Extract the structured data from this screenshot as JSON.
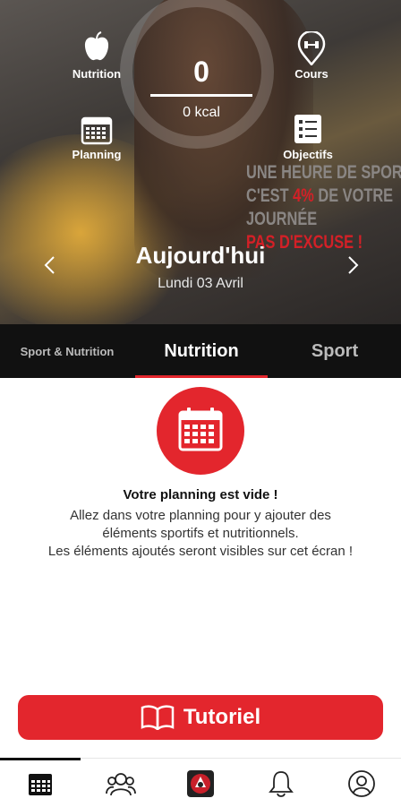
{
  "header": {
    "menu": {
      "nutrition": {
        "label": "Nutrition",
        "icon": "apple-icon"
      },
      "cours": {
        "label": "Cours",
        "icon": "dumbbell-pin-icon"
      },
      "planning": {
        "label": "Planning",
        "icon": "calendar-icon"
      },
      "objectifs": {
        "label": "Objectifs",
        "icon": "checklist-icon"
      }
    },
    "calories": {
      "value": "0",
      "label": "0 kcal"
    },
    "slogan": {
      "line1": "UNE HEURE DE SPORT",
      "line2_a": "C'EST ",
      "line2_pct": "4%",
      "line2_b": " DE VOTRE",
      "line3": "JOURNÉE",
      "line4": "PAS D'EXCUSE !"
    },
    "day": {
      "title": "Aujourd'hui",
      "date": "Lundi 03 Avril"
    }
  },
  "tabs": [
    {
      "label": "Sport & Nutrition",
      "active": false
    },
    {
      "label": "Nutrition",
      "active": true
    },
    {
      "label": "Sport",
      "active": false
    }
  ],
  "empty_state": {
    "icon": "calendar-icon",
    "title": "Votre planning est vide !",
    "line1": "Allez dans votre planning pour y ajouter des",
    "line2": "éléments sportifs et nutritionnels.",
    "line3": "Les éléments ajoutés seront visibles sur cet écran !"
  },
  "tutorial_button": {
    "label": "Tutoriel",
    "icon": "book-icon"
  },
  "bottom_nav": [
    {
      "icon": "calendar-icon",
      "active": true
    },
    {
      "icon": "users-icon",
      "active": false
    },
    {
      "icon": "club-logo",
      "active": false
    },
    {
      "icon": "bell-icon",
      "active": false
    },
    {
      "icon": "user-icon",
      "active": false
    }
  ],
  "colors": {
    "accent": "#e3262d",
    "tabs_bg": "#111111"
  }
}
